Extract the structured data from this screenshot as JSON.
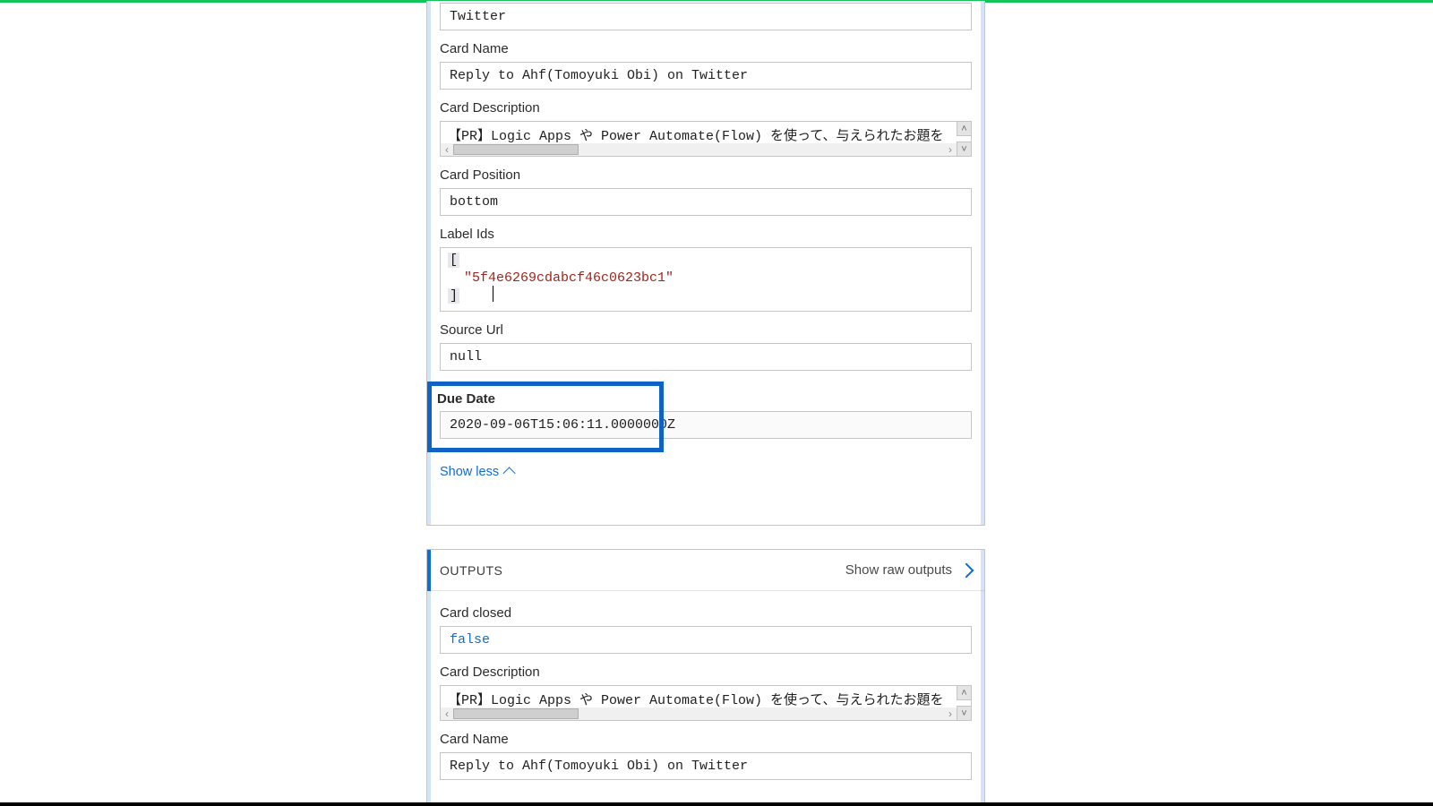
{
  "inputs": {
    "board_or_list": "Twitter",
    "card_name_label": "Card Name",
    "card_name": "Reply to Ahf(Tomoyuki Obi) on Twitter",
    "card_description_label": "Card Description",
    "card_description": "【PR】Logic Apps や Power Automate(Flow) を使って、与えられたお題を",
    "card_position_label": "Card Position",
    "card_position": "bottom",
    "label_ids_label": "Label Ids",
    "label_ids_open": "[",
    "label_ids_value": "\"5f4e6269cdabcf46c0623bc1\"",
    "label_ids_close": "]",
    "source_url_label": "Source Url",
    "source_url": "null",
    "due_date_label": "Due Date",
    "due_date": "2020-09-06T15:06:11.0000000Z",
    "show_less": "Show less"
  },
  "outputs": {
    "header": "OUTPUTS",
    "show_raw": "Show raw outputs",
    "card_closed_label": "Card closed",
    "card_closed": "false",
    "card_description_label": "Card Description",
    "card_description": "【PR】Logic Apps や Power Automate(Flow) を使って、与えられたお題を",
    "card_name_label": "Card Name",
    "card_name": "Reply to Ahf(Tomoyuki Obi) on Twitter"
  }
}
